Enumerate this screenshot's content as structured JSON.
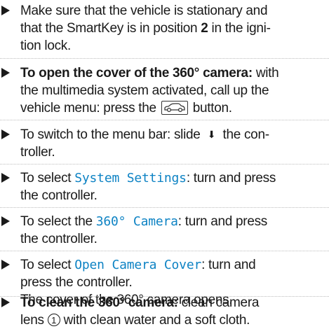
{
  "steps": [
    {
      "line1": "Make sure that the vehicle is stationary and",
      "line2_a": "that the SmartKey is in position ",
      "line2_bold": "2",
      "line2_b": " in the igni-",
      "line3": "tion lock."
    },
    {
      "bold": "To open the cover of the 360° camera:",
      "line1_rest": " with",
      "line2": "the multimedia system activated, call up the",
      "line3_a": "vehicle menu: press the ",
      "line3_b": " button.",
      "button_icon": "vehicle-button-icon"
    },
    {
      "line1_a": "To switch to the menu bar: slide ",
      "arrow": "⬇",
      "line1_b": " the con-",
      "line2": "troller."
    },
    {
      "line1_a": "To select ",
      "menu": "System Settings",
      "line1_b": ": turn and press",
      "line2": "the controller."
    },
    {
      "line1_a": "To select the ",
      "menu": "360° Camera",
      "line1_b": ": turn and press",
      "line2": "the controller."
    },
    {
      "line1_a": "To select ",
      "menu": "Open Camera Cover",
      "line1_b": ": turn and",
      "line2": "press the controller.",
      "result": "The cover of the 360° camera opens."
    },
    {
      "bold": "To clean the 360° camera:",
      "line1_rest": " clean camera",
      "line2_a": "lens ",
      "marker": "1",
      "line2_b": " with clean water and a soft cloth."
    }
  ],
  "colors": {
    "text": "#1a1a1a",
    "menu_item": "#0e83c4",
    "divider": "#bdbdbd"
  }
}
